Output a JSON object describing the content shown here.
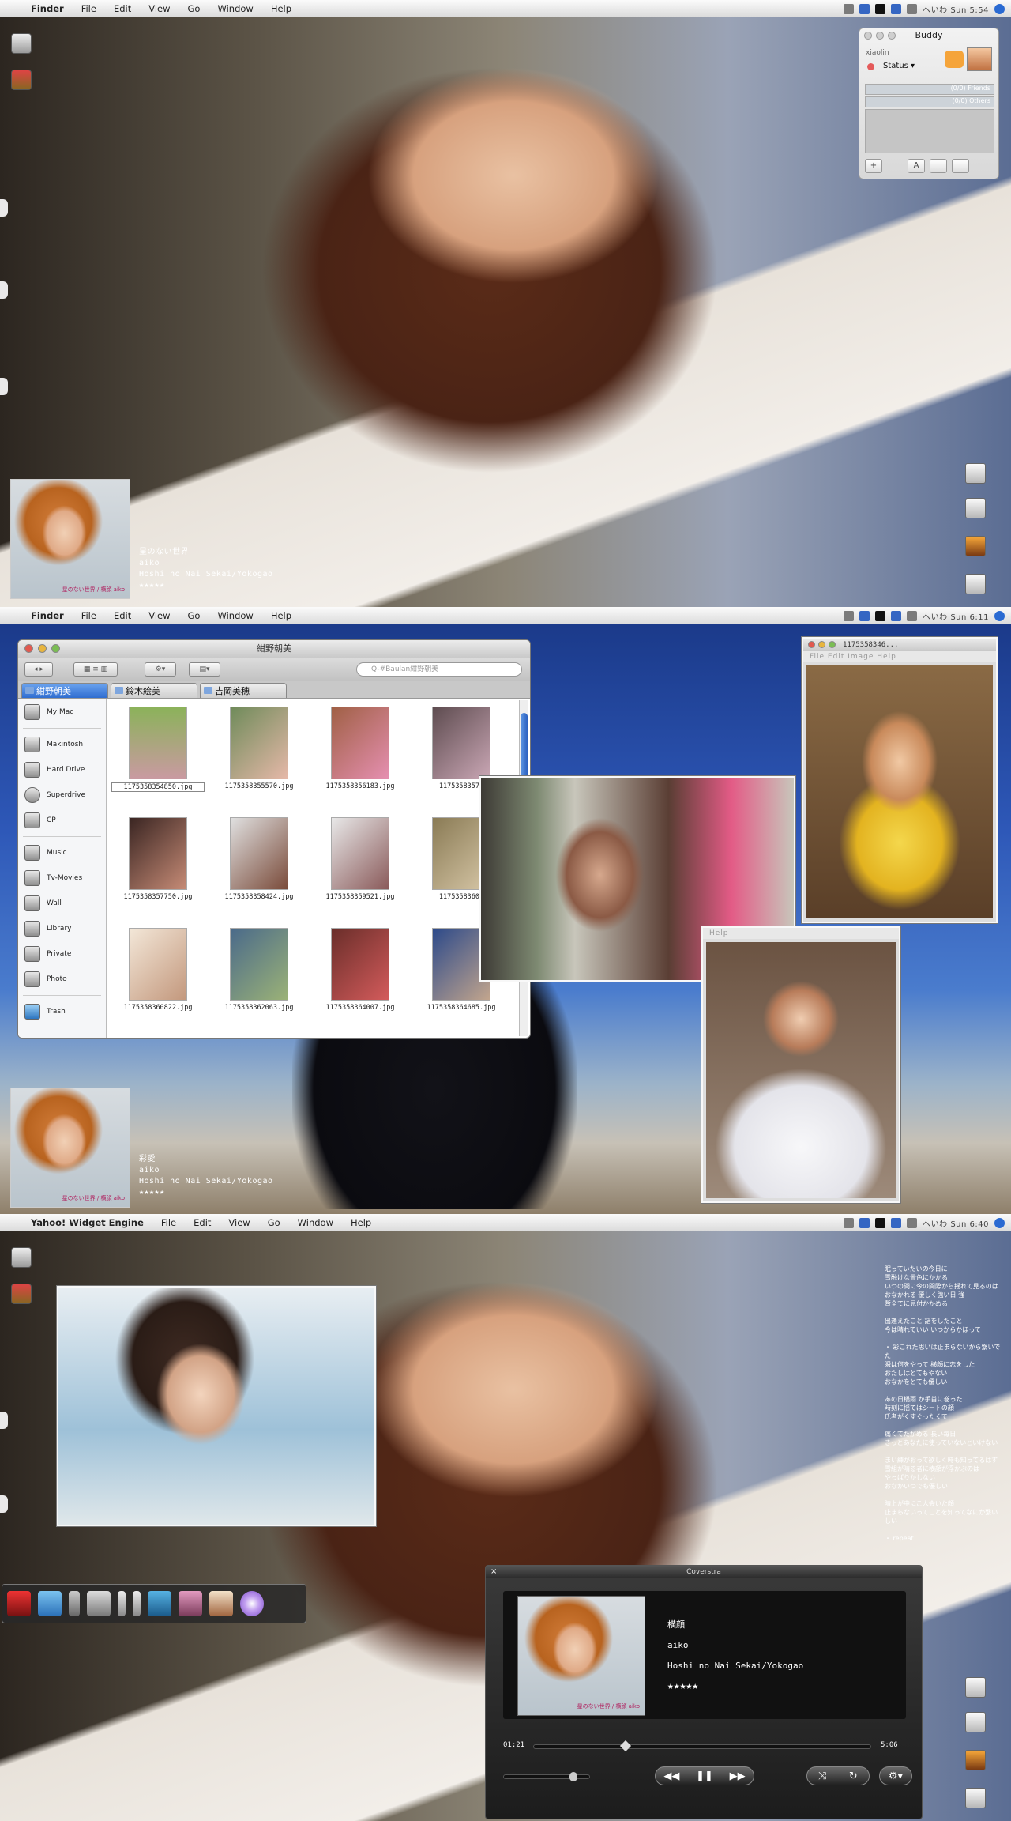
{
  "menus": {
    "apple": "",
    "s1": [
      "Finder",
      "File",
      "Edit",
      "View",
      "Go",
      "Window",
      "Help"
    ],
    "s2": [
      "Finder",
      "File",
      "Edit",
      "View",
      "Go",
      "Window",
      "Help"
    ],
    "s3": [
      "Yahoo! Widget Engine",
      "File",
      "Edit",
      "View",
      "Go",
      "Window",
      "Help"
    ]
  },
  "clock": {
    "s1": "へいわ Sun 5:54",
    "s2": "へいわ Sun 6:11",
    "s3": "へいわ Sun 6:40"
  },
  "buddy": {
    "title": "Buddy",
    "user": "xiaolin",
    "status": "Status ▾",
    "groups": [
      "(0/0) Friends",
      "(0/0) Others"
    ],
    "buttons": [
      "+",
      "A"
    ]
  },
  "now_playing_1": {
    "title": "星のない世界",
    "artist": "aiko",
    "album": "Hoshi no Nai Sekai/Yokogao",
    "rating": "★★★★★"
  },
  "now_playing_2": {
    "title": "彩愛",
    "artist": "aiko",
    "album": "Hoshi no Nai Sekai/Yokogao",
    "rating": "★★★★★"
  },
  "cover_caption": "星のない世界 / 横顔  aiko",
  "finder": {
    "title": "紺野朝美",
    "search": "Q-#Baulan紺野朝美",
    "tabs": [
      "紺野朝美",
      "鈴木絵美",
      "吉岡美穂"
    ],
    "sidebar": [
      "My Mac",
      "Makintosh",
      "Hard Drive",
      "Superdrive",
      "CP",
      "Music",
      "Tv-Movies",
      "Wall",
      "Library",
      "Private",
      "Photo",
      "Trash"
    ],
    "files": [
      "1175358354850.jpg",
      "1175358355570.jpg",
      "1175358356183.jpg",
      "11753583574",
      "1175358357750.jpg",
      "1175358358424.jpg",
      "1175358359521.jpg",
      "11753583601",
      "1175358360822.jpg",
      "1175358362063.jpg",
      "1175358364007.jpg",
      "1175358364685.jpg"
    ]
  },
  "photo_viewer": {
    "title": "1175358346...",
    "menu": "File  Edit  Image  Help",
    "menu2": "Help"
  },
  "lyrics": "眠っていたいの今日に\n 雪融けな景色にかかる \n いつの間に今の間際から揺れて見るのは\n おなかれる 優しく強い日 強\n  暫全てに見付かかめる\n\n出逢えたこと 話をしたこと\n 今は晴れていい いつからかほって\n\n・ 彩これた思いは止まらないから繋いでた\n 瞬は何をやって 横顔に恋をした\n おたしはとてもやない\n おなかをとても優しい\n\nあの日橋雨 か手首に巻った\n 時刻に揺てはシートの顔\n  氏者がくすぐったくて\n\n痛くてたがめる 長い毎日\n きっとあなたに使っていないといけない\n\nまい練がおって欲しく時も知ってるはず\n 雪組が晴る者に横顔が浮かぶのは\n やっぱりかしない\n おなかいつでも優しい\n\n晴上が中にこ人会いた顔\n 止まらないってことを知ってなにか繋いしい\n\n・ repeat",
  "player": {
    "window_title": "Coverstra",
    "close": "×",
    "title": "横顔",
    "artist": "aiko",
    "album": "Hoshi no Nai Sekai/Yokogao",
    "rating": "★★★★★",
    "elapsed": "01:21",
    "total": "5:06",
    "progress": 0.27,
    "volume": 0.8,
    "btn_prev": "◀◀",
    "btn_pause": "❚❚",
    "btn_next": "▶▶",
    "btn_shuffle": "⤨",
    "btn_repeat": "↻",
    "btn_settings": "⚙▾"
  },
  "colors": {
    "accent": "#2f6dd0",
    "menubar": "#e8e8e8"
  }
}
